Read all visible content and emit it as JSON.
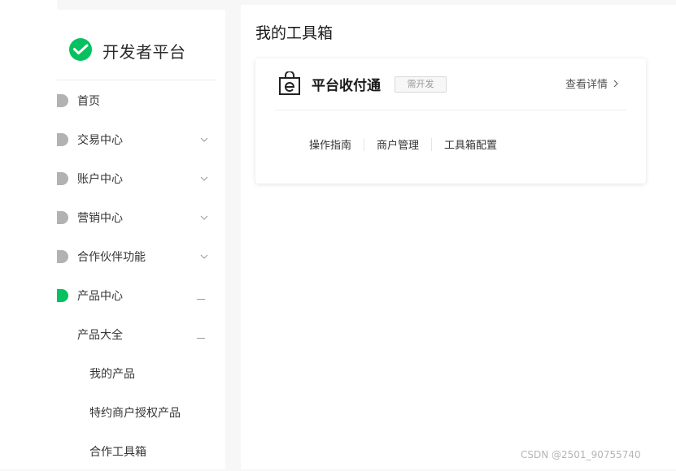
{
  "brand": {
    "name": "开发者平台",
    "accent": "#07c160"
  },
  "sidebar": {
    "items": [
      {
        "label": "首页",
        "dot_color": "#b2b2b2"
      },
      {
        "label": "交易中心",
        "dot_color": "#b2b2b2",
        "icon": "chevron-down-icon"
      },
      {
        "label": "账户中心",
        "dot_color": "#b2b2b2",
        "icon": "chevron-down-icon"
      },
      {
        "label": "营销中心",
        "dot_color": "#b2b2b2",
        "icon": "chevron-down-icon"
      },
      {
        "label": "合作伙伴功能",
        "dot_color": "#b2b2b2",
        "icon": "chevron-down-icon"
      },
      {
        "label": "产品中心",
        "dot_color": "#07c160",
        "icon": "collapse-dash-icon"
      }
    ],
    "sub_group": {
      "label": "产品大全",
      "icon": "collapse-dash-icon"
    },
    "sub_items": [
      {
        "label": "我的产品"
      },
      {
        "label": "特约商户授权产品"
      },
      {
        "label": "合作工具箱"
      }
    ]
  },
  "main": {
    "title": "我的工具箱",
    "card": {
      "icon": "shopping-bag-e-icon",
      "title": "平台收付通",
      "tag": "需开发",
      "detail_link": "查看详情",
      "links": [
        "操作指南",
        "商户管理",
        "工具箱配置"
      ]
    }
  },
  "watermark": "CSDN @2501_90755740"
}
